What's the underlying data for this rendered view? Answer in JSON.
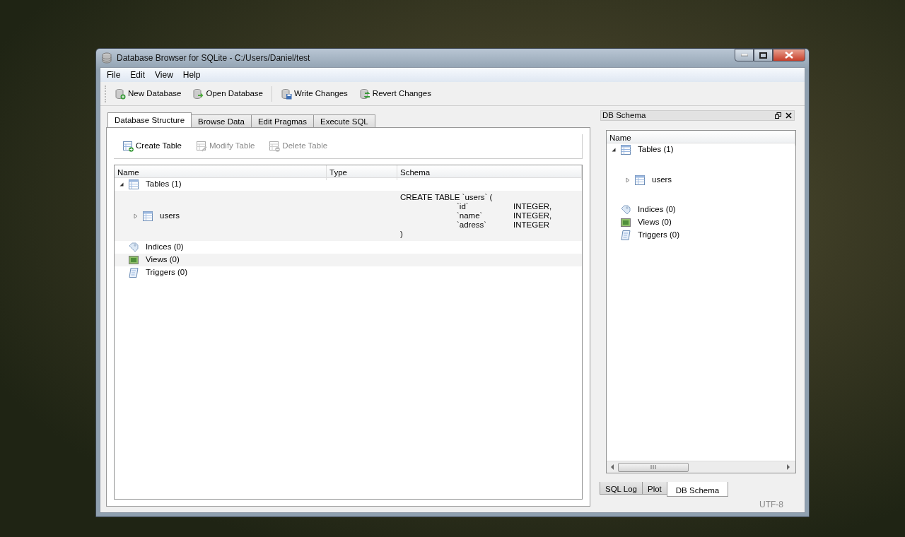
{
  "window": {
    "title": "Database Browser for SQLite - C:/Users/Daniel/test"
  },
  "menu": [
    "File",
    "Edit",
    "View",
    "Help"
  ],
  "toolbar": [
    {
      "label": "New Database",
      "kind": "new"
    },
    {
      "label": "Open Database",
      "kind": "open"
    },
    {
      "label": "Write Changes",
      "kind": "write"
    },
    {
      "label": "Revert Changes",
      "kind": "revert"
    }
  ],
  "tabs": [
    {
      "label": "Database Structure",
      "selected": true
    },
    {
      "label": "Browse Data",
      "selected": false
    },
    {
      "label": "Edit Pragmas",
      "selected": false
    },
    {
      "label": "Execute SQL",
      "selected": false
    }
  ],
  "structure_toolbar": [
    {
      "label": "Create Table",
      "disabled": false
    },
    {
      "label": "Modify Table",
      "disabled": true
    },
    {
      "label": "Delete Table",
      "disabled": true
    }
  ],
  "structure_tree": {
    "columns": [
      "Name",
      "Type",
      "Schema"
    ],
    "rows": [
      {
        "label": "Tables (1)",
        "kind": "table",
        "expanded": true,
        "children": [
          {
            "label": "users",
            "kind": "table",
            "expanded": false,
            "schema": {
              "header": "CREATE TABLE `users` (",
              "fields": [
                {
                  "name": "`id`",
                  "type": "INTEGER,"
                },
                {
                  "name": "`name`",
                  "type": "INTEGER,"
                },
                {
                  "name": "`adress`",
                  "type": "INTEGER"
                }
              ],
              "footer": ")"
            }
          }
        ]
      },
      {
        "label": "Indices (0)",
        "kind": "index"
      },
      {
        "label": "Views (0)",
        "kind": "view"
      },
      {
        "label": "Triggers (0)",
        "kind": "trigger"
      }
    ]
  },
  "dock": {
    "title": "DB Schema",
    "tree": {
      "columns": [
        "Name"
      ],
      "rows": [
        {
          "label": "Tables (1)",
          "kind": "table",
          "expanded": true,
          "children": [
            {
              "label": "users",
              "kind": "table",
              "expanded": false
            }
          ]
        },
        {
          "label": "Indices (0)",
          "kind": "index"
        },
        {
          "label": "Views (0)",
          "kind": "view"
        },
        {
          "label": "Triggers (0)",
          "kind": "trigger"
        }
      ]
    },
    "tabs": [
      {
        "label": "SQL Log",
        "selected": false
      },
      {
        "label": "Plot",
        "selected": false
      },
      {
        "label": "DB Schema",
        "selected": true
      }
    ]
  },
  "status_bar": {
    "encoding": "UTF-8"
  }
}
